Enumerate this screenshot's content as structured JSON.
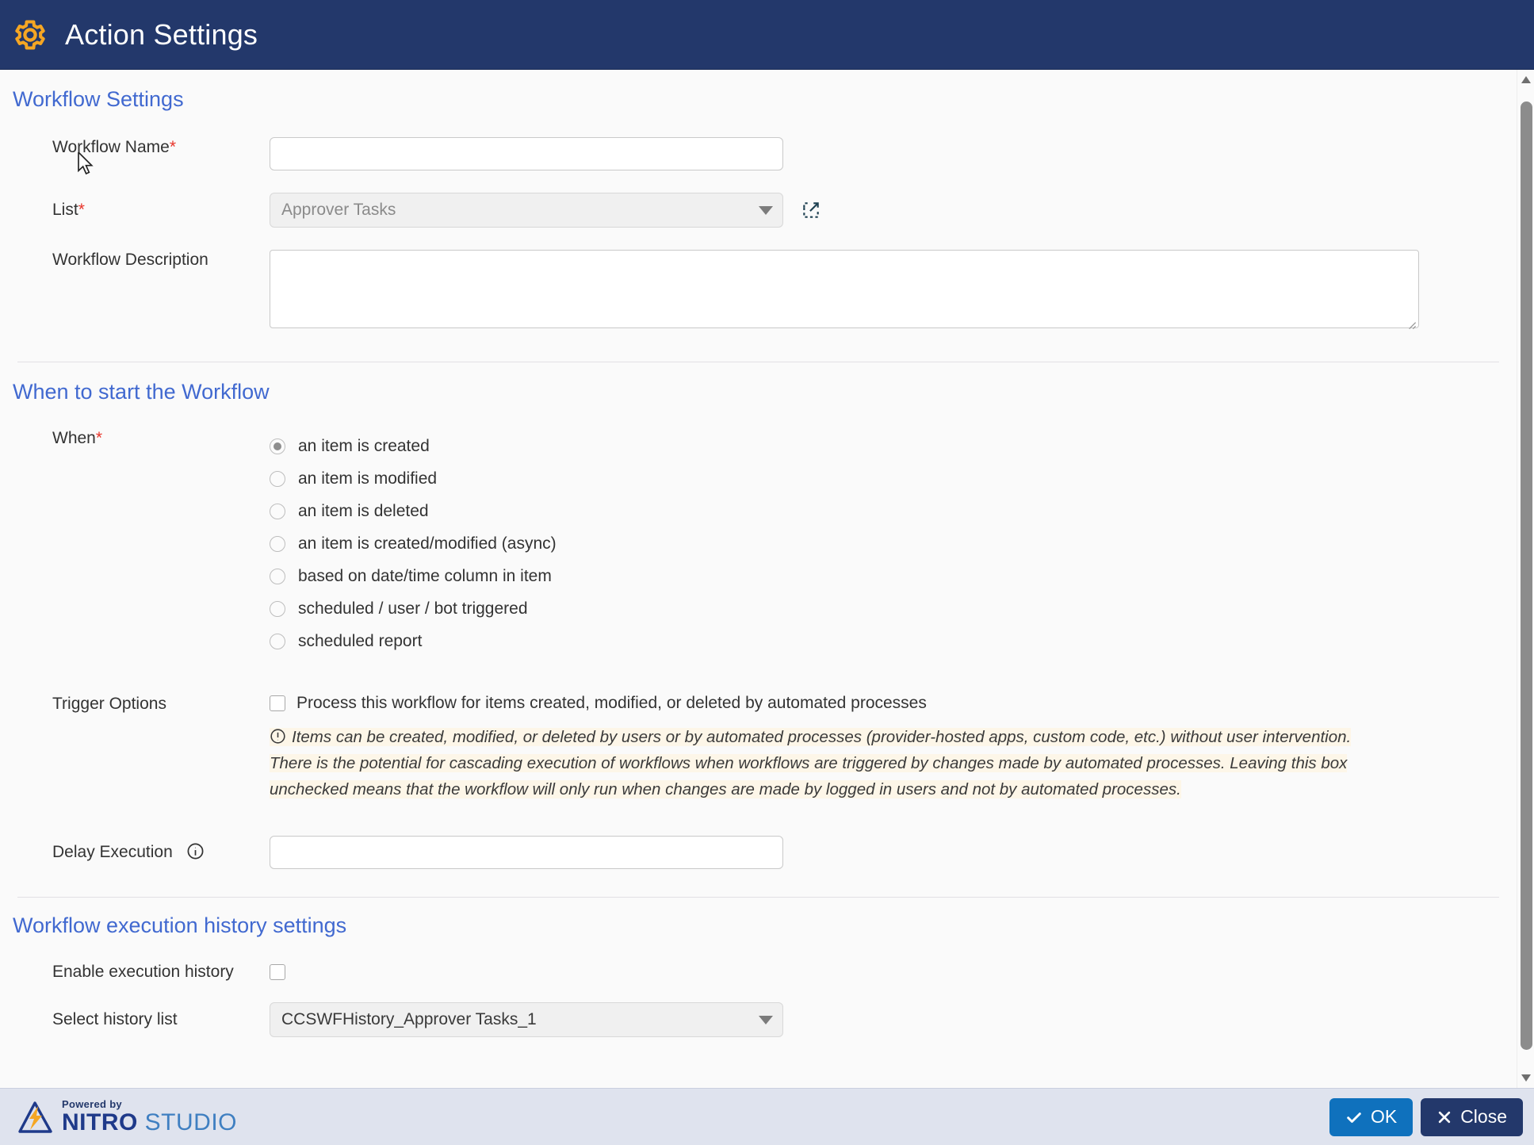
{
  "header": {
    "title": "Action Settings",
    "icon": "gear-icon",
    "bg_color": "#23386b",
    "icon_color": "#f5a623"
  },
  "sections": {
    "workflow_settings": {
      "title": "Workflow Settings",
      "workflow_name": {
        "label": "Workflow Name",
        "required": "*",
        "value": "",
        "placeholder": ""
      },
      "list": {
        "label": "List",
        "required": "*",
        "value": "Approver Tasks",
        "disabled": true,
        "open_icon": "external-link-icon"
      },
      "workflow_description": {
        "label": "Workflow Description",
        "value": "",
        "placeholder": ""
      }
    },
    "when_to_start": {
      "title": "When to start the Workflow",
      "when": {
        "label": "When",
        "required": "*",
        "selected": "an item is created",
        "options": [
          "an item is created",
          "an item is modified",
          "an item is deleted",
          "an item is created/modified (async)",
          "based on date/time column in item",
          "scheduled / user / bot triggered",
          "scheduled report"
        ]
      },
      "trigger_options": {
        "label": "Trigger Options",
        "checkbox_label": "Process this workflow for items created, modified, or deleted by automated processes",
        "checked": false,
        "note_icon": "warning-circle-icon",
        "note": "Items can be created, modified, or deleted by users or by automated processes (provider-hosted apps, custom code, etc.) without user intervention. There is the potential for cascading execution of workflows when workflows are triggered by changes made by automated processes. Leaving this box unchecked means that the workflow will only run when changes are made by logged in users and not by automated processes.",
        "note_bg": "#fdf6e8"
      },
      "delay_execution": {
        "label": "Delay Execution",
        "info_icon": "info-circle-icon",
        "value": "",
        "placeholder": ""
      }
    },
    "history_settings": {
      "title": "Workflow execution history settings",
      "enable_execution_history": {
        "label": "Enable execution history",
        "checked": false
      },
      "select_history_list": {
        "label": "Select history list",
        "value": "CCSWFHistory_Approver Tasks_1",
        "disabled": true
      }
    }
  },
  "footer": {
    "logo": {
      "powered_by": "Powered by",
      "brand_bold": "NITRO",
      "brand_light": " STUDIO",
      "mark": "nitro-bolt-logo"
    },
    "ok_button": {
      "label": "OK",
      "icon": "check-icon",
      "color": "#0f71bd"
    },
    "close_button": {
      "label": "Close",
      "icon": "close-x-icon",
      "color": "#23386b"
    }
  },
  "scrollbar": {
    "up_icon": "scroll-up-arrow-icon",
    "down_icon": "scroll-down-arrow-icon"
  }
}
